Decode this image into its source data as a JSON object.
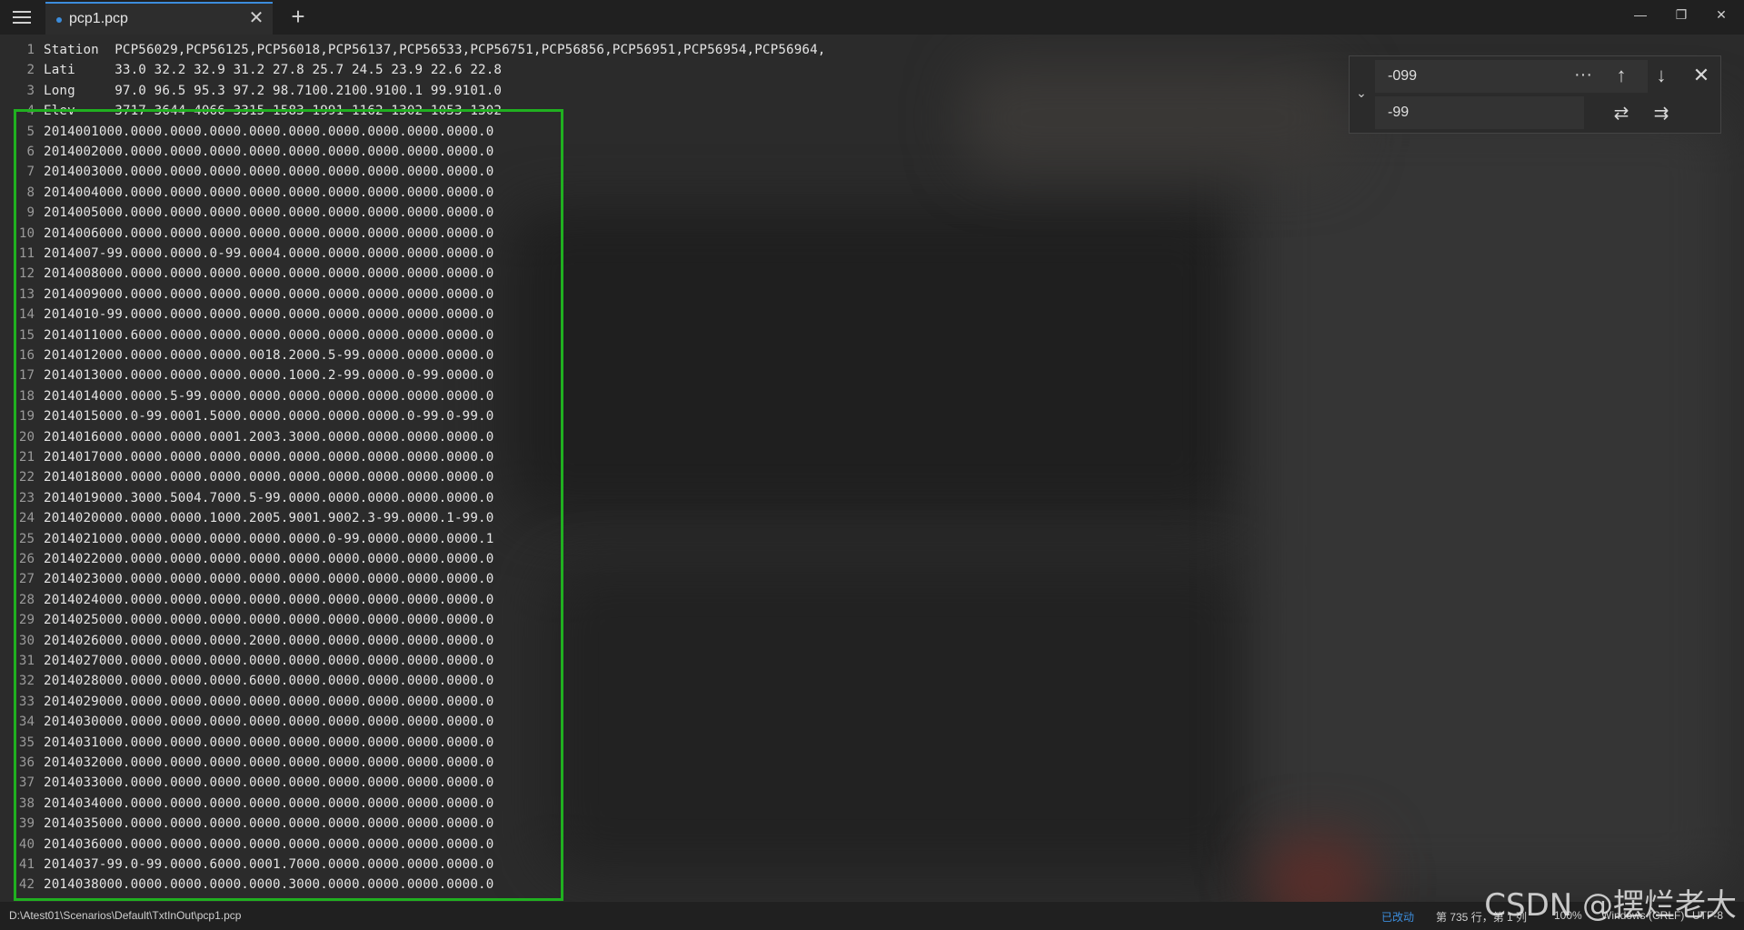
{
  "tab": {
    "title": "pcp1.pcp",
    "close": "✕",
    "new": "+"
  },
  "window": {
    "minimize": "—",
    "restore": "❐",
    "close": "✕"
  },
  "lines": [
    {
      "n": "1",
      "t": "Station  PCP56029,PCP56125,PCP56018,PCP56137,PCP56533,PCP56751,PCP56856,PCP56951,PCP56954,PCP56964,"
    },
    {
      "n": "2",
      "t": "Lati     33.0 32.2 32.9 31.2 27.8 25.7 24.5 23.9 22.6 22.8"
    },
    {
      "n": "3",
      "t": "Long     97.0 96.5 95.3 97.2 98.7100.2100.9100.1 99.9101.0"
    },
    {
      "n": "4",
      "t": "Elev     3717 3644 4066 3315 1583 1991 1162 1302 1053 1302"
    },
    {
      "n": "5",
      "t": "2014001000.0000.0000.0000.0000.0000.0000.0000.0000.0000.0"
    },
    {
      "n": "6",
      "t": "2014002000.0000.0000.0000.0000.0000.0000.0000.0000.0000.0"
    },
    {
      "n": "7",
      "t": "2014003000.0000.0000.0000.0000.0000.0000.0000.0000.0000.0"
    },
    {
      "n": "8",
      "t": "2014004000.0000.0000.0000.0000.0000.0000.0000.0000.0000.0"
    },
    {
      "n": "9",
      "t": "2014005000.0000.0000.0000.0000.0000.0000.0000.0000.0000.0"
    },
    {
      "n": "10",
      "t": "2014006000.0000.0000.0000.0000.0000.0000.0000.0000.0000.0"
    },
    {
      "n": "11",
      "t": "2014007-99.0000.0000.0-99.0004.0000.0000.0000.0000.0000.0"
    },
    {
      "n": "12",
      "t": "2014008000.0000.0000.0000.0000.0000.0000.0000.0000.0000.0"
    },
    {
      "n": "13",
      "t": "2014009000.0000.0000.0000.0000.0000.0000.0000.0000.0000.0"
    },
    {
      "n": "14",
      "t": "2014010-99.0000.0000.0000.0000.0000.0000.0000.0000.0000.0"
    },
    {
      "n": "15",
      "t": "2014011000.6000.0000.0000.0000.0000.0000.0000.0000.0000.0"
    },
    {
      "n": "16",
      "t": "2014012000.0000.0000.0000.0018.2000.5-99.0000.0000.0000.0"
    },
    {
      "n": "17",
      "t": "2014013000.0000.0000.0000.0000.1000.2-99.0000.0-99.0000.0"
    },
    {
      "n": "18",
      "t": "2014014000.0000.5-99.0000.0000.0000.0000.0000.0000.0000.0"
    },
    {
      "n": "19",
      "t": "2014015000.0-99.0001.5000.0000.0000.0000.0000.0-99.0-99.0"
    },
    {
      "n": "20",
      "t": "2014016000.0000.0000.0001.2003.3000.0000.0000.0000.0000.0"
    },
    {
      "n": "21",
      "t": "2014017000.0000.0000.0000.0000.0000.0000.0000.0000.0000.0"
    },
    {
      "n": "22",
      "t": "2014018000.0000.0000.0000.0000.0000.0000.0000.0000.0000.0"
    },
    {
      "n": "23",
      "t": "2014019000.3000.5004.7000.5-99.0000.0000.0000.0000.0000.0"
    },
    {
      "n": "24",
      "t": "2014020000.0000.0000.1000.2005.9001.9002.3-99.0000.1-99.0"
    },
    {
      "n": "25",
      "t": "2014021000.0000.0000.0000.0000.0000.0-99.0000.0000.0000.1"
    },
    {
      "n": "26",
      "t": "2014022000.0000.0000.0000.0000.0000.0000.0000.0000.0000.0"
    },
    {
      "n": "27",
      "t": "2014023000.0000.0000.0000.0000.0000.0000.0000.0000.0000.0"
    },
    {
      "n": "28",
      "t": "2014024000.0000.0000.0000.0000.0000.0000.0000.0000.0000.0"
    },
    {
      "n": "29",
      "t": "2014025000.0000.0000.0000.0000.0000.0000.0000.0000.0000.0"
    },
    {
      "n": "30",
      "t": "2014026000.0000.0000.0000.2000.0000.0000.0000.0000.0000.0"
    },
    {
      "n": "31",
      "t": "2014027000.0000.0000.0000.0000.0000.0000.0000.0000.0000.0"
    },
    {
      "n": "32",
      "t": "2014028000.0000.0000.0000.6000.0000.0000.0000.0000.0000.0"
    },
    {
      "n": "33",
      "t": "2014029000.0000.0000.0000.0000.0000.0000.0000.0000.0000.0"
    },
    {
      "n": "34",
      "t": "2014030000.0000.0000.0000.0000.0000.0000.0000.0000.0000.0"
    },
    {
      "n": "35",
      "t": "2014031000.0000.0000.0000.0000.0000.0000.0000.0000.0000.0"
    },
    {
      "n": "36",
      "t": "2014032000.0000.0000.0000.0000.0000.0000.0000.0000.0000.0"
    },
    {
      "n": "37",
      "t": "2014033000.0000.0000.0000.0000.0000.0000.0000.0000.0000.0"
    },
    {
      "n": "38",
      "t": "2014034000.0000.0000.0000.0000.0000.0000.0000.0000.0000.0"
    },
    {
      "n": "39",
      "t": "2014035000.0000.0000.0000.0000.0000.0000.0000.0000.0000.0"
    },
    {
      "n": "40",
      "t": "2014036000.0000.0000.0000.0000.0000.0000.0000.0000.0000.0"
    },
    {
      "n": "41",
      "t": "2014037-99.0-99.0000.6000.0001.7000.0000.0000.0000.0000.0"
    },
    {
      "n": "42",
      "t": "2014038000.0000.0000.0000.0000.3000.0000.0000.0000.0000.0"
    }
  ],
  "find": {
    "search_value": "-099",
    "replace_value": "-99",
    "more": "···",
    "toggle": "⌄",
    "prev": "↑",
    "next": "↓",
    "close": "✕",
    "replace_one": "⇄",
    "replace_all": "⇉"
  },
  "status": {
    "path": "D:\\Atest01\\Scenarios\\Default\\TxtInOut\\pcp1.pcp",
    "modified": "已改动",
    "position": "第 735 行，第 1 列",
    "zoom": "100%",
    "line_ending": "Windows (CRLF)",
    "encoding": "UTF-8"
  },
  "watermark": "CSDN @摆烂老大",
  "colors": {
    "accent": "#3c8ddc",
    "highlight_box": "#20b020"
  }
}
